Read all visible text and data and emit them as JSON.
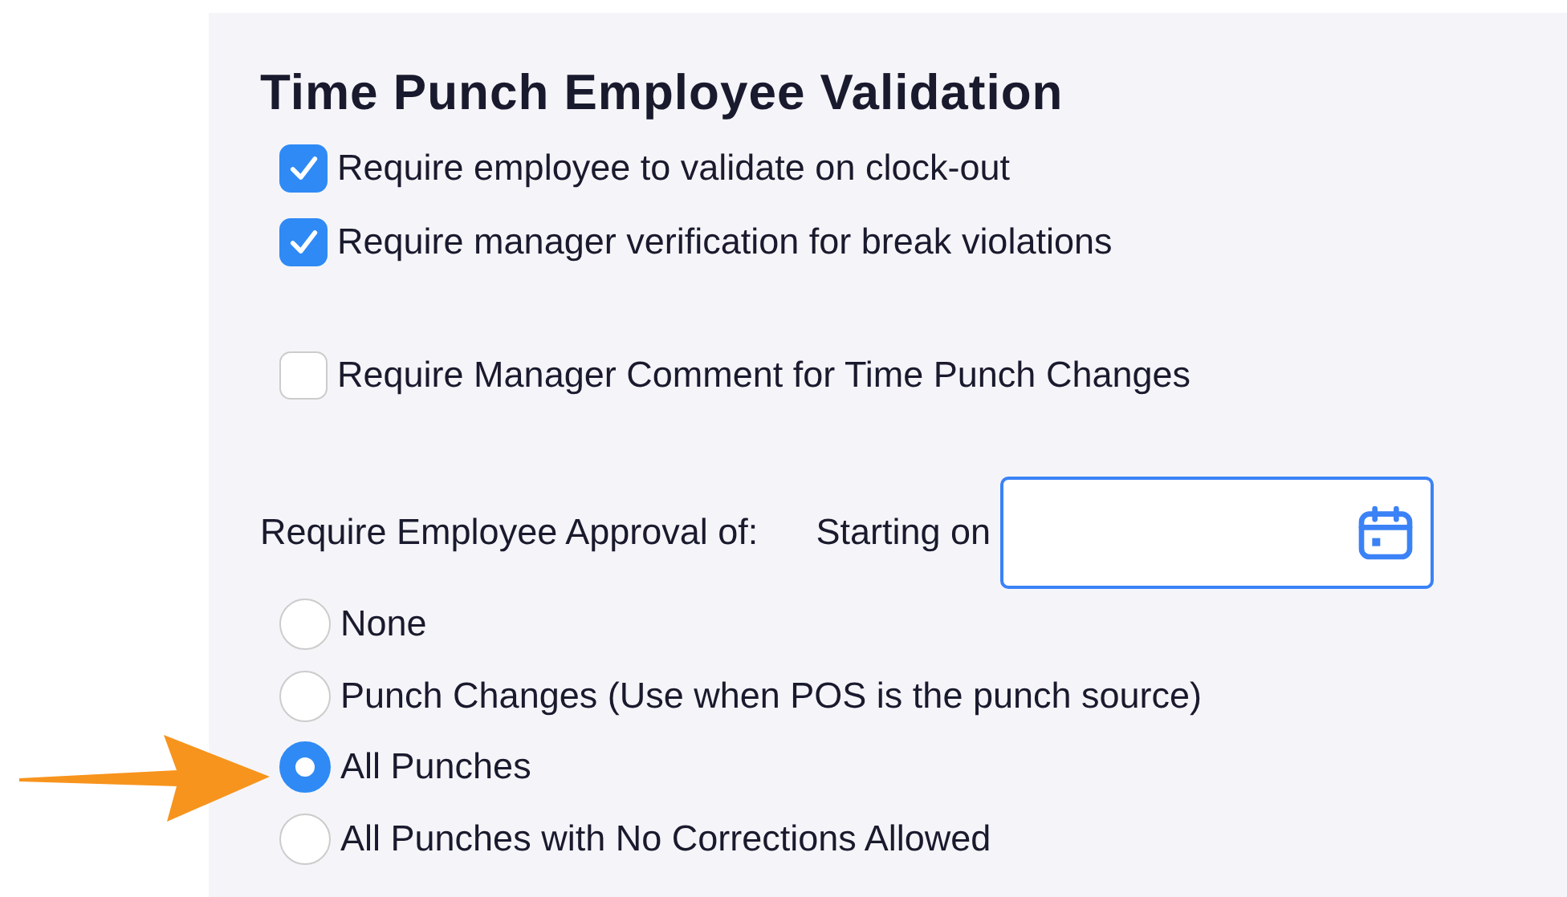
{
  "title": "Time Punch Employee Validation",
  "checkboxes": [
    {
      "label": "Require employee to validate on clock-out",
      "checked": true
    },
    {
      "label": "Require manager verification for break violations",
      "checked": true
    },
    {
      "label": "Require Manager Comment for Time Punch Changes",
      "checked": false
    }
  ],
  "approval": {
    "label": "Require Employee Approval of:",
    "starting_label": "Starting on"
  },
  "options": [
    {
      "label": "None",
      "selected": false
    },
    {
      "label": "Punch Changes (Use when POS is the punch source)",
      "selected": false
    },
    {
      "label": "All Punches",
      "selected": true
    },
    {
      "label": "All Punches with No Corrections Allowed",
      "selected": false
    }
  ]
}
